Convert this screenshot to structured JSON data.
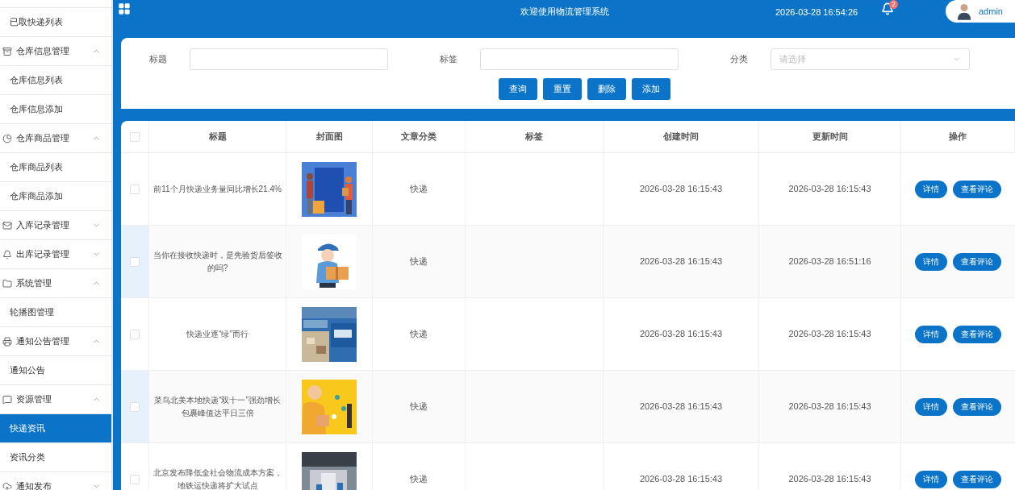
{
  "sidebar": {
    "items": [
      {
        "kind": "item",
        "label": "已取快递列表",
        "selected": false
      },
      {
        "kind": "group",
        "label": "仓库信息管理",
        "expanded": true
      },
      {
        "kind": "item",
        "label": "仓库信息列表",
        "selected": false
      },
      {
        "kind": "item",
        "label": "仓库信息添加",
        "selected": false
      },
      {
        "kind": "group",
        "label": "仓库商品管理",
        "expanded": true
      },
      {
        "kind": "item",
        "label": "仓库商品列表",
        "selected": false
      },
      {
        "kind": "item",
        "label": "仓库商品添加",
        "selected": false
      },
      {
        "kind": "group",
        "label": "入库记录管理",
        "expanded": false
      },
      {
        "kind": "group",
        "label": "出库记录管理",
        "expanded": false
      },
      {
        "kind": "group",
        "label": "系统管理",
        "expanded": true
      },
      {
        "kind": "item",
        "label": "轮播图管理",
        "selected": false
      },
      {
        "kind": "group",
        "label": "通知公告管理",
        "expanded": true
      },
      {
        "kind": "item",
        "label": "通知公告",
        "selected": false
      },
      {
        "kind": "group",
        "label": "资源管理",
        "expanded": true
      },
      {
        "kind": "item",
        "label": "快递资讯",
        "selected": true
      },
      {
        "kind": "item",
        "label": "资讯分类",
        "selected": false
      },
      {
        "kind": "group",
        "label": "通知发布",
        "expanded": false
      }
    ]
  },
  "header": {
    "title": "欢迎使用物流管理系统",
    "datetime": "2026-03-28 16:54:26",
    "notification_count": "2",
    "user": "admin"
  },
  "search": {
    "fields": [
      {
        "label": "标题",
        "kind": "input"
      },
      {
        "label": "标签",
        "kind": "input"
      },
      {
        "label": "分类",
        "kind": "select",
        "placeholder": "请选择"
      }
    ],
    "buttons": [
      "查询",
      "重置",
      "删除",
      "添加"
    ]
  },
  "table": {
    "select_all_checked": false,
    "columns": [
      "标题",
      "封面图",
      "文章分类",
      "标签",
      "创建时间",
      "更新时间",
      "操作"
    ],
    "rows": [
      {
        "checked": false,
        "title": "前11个月快递业务量同比增长21.4%",
        "category": "快递",
        "tags": "",
        "created": "2026-03-28 16:15:43",
        "updated": "2026-03-28 16:15:43",
        "actions": [
          "详情",
          "查看评论"
        ]
      },
      {
        "checked": false,
        "title": "当你在接收快递时，是先验货后签收的吗?",
        "category": "快递",
        "tags": "",
        "created": "2026-03-28 16:15:43",
        "updated": "2026-03-28 16:51:16",
        "actions": [
          "详情",
          "查看评论"
        ]
      },
      {
        "checked": false,
        "title": "快递业逐“绿”而行",
        "category": "快递",
        "tags": "",
        "created": "2026-03-28 16:15:43",
        "updated": "2026-03-28 16:15:43",
        "actions": [
          "详情",
          "查看评论"
        ]
      },
      {
        "checked": false,
        "title": "菜鸟北美本地快递“双十一”强劲增长包裹峰值达平日三倍",
        "category": "快递",
        "tags": "",
        "created": "2026-03-28 16:15:43",
        "updated": "2026-03-28 16:15:43",
        "actions": [
          "详情",
          "查看评论"
        ]
      },
      {
        "checked": false,
        "title": "北京发布降低全社会物流成本方案，地铁运快递将扩大试点",
        "category": "快递",
        "tags": "",
        "created": "2026-03-28 16:15:43",
        "updated": "2026-03-28 16:15:43",
        "actions": [
          "详情",
          "查看评论"
        ]
      }
    ]
  }
}
